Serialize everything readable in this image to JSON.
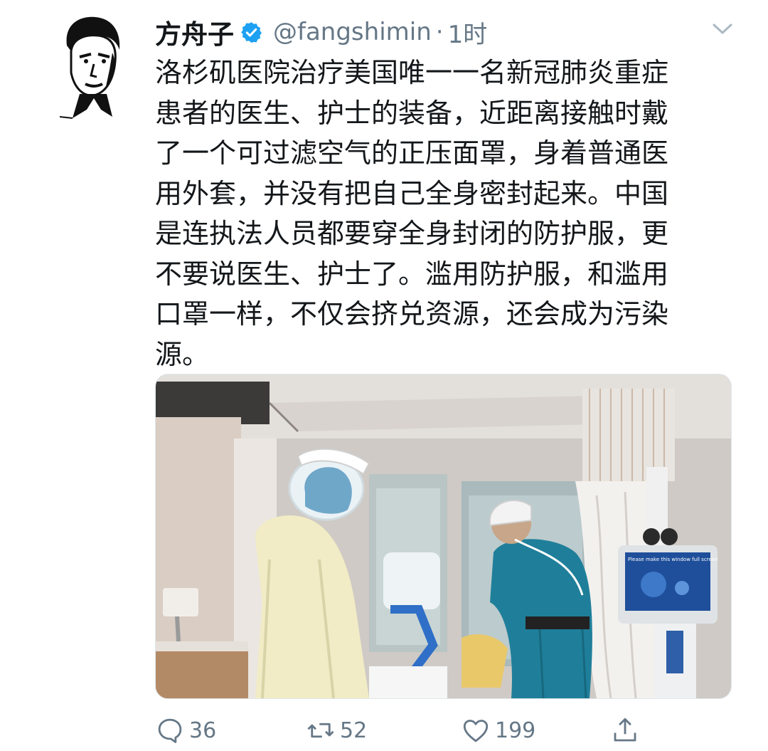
{
  "tweet": {
    "display_name": "方舟子",
    "handle": "@fangshimin",
    "separator": "·",
    "time": "1时",
    "verified": true,
    "text_lines": [
      "洛杉矶医院治疗美国唯一一名新冠肺炎重症",
      "患者的医生、护士的装备，近距离接触时戴",
      "了一个可过滤空气的正压面罩，身着普通医",
      "用外套，并没有把自己全身密封起来。中国",
      "是连执法人员都要穿全身封闭的防护服，更",
      "不要说医生、护士了。滥用防护服，和滥用",
      "口罩一样，不仅会挤兑资源，还会成为污染",
      "源。"
    ],
    "monitor_text": "Please make this window full screen",
    "actions": {
      "reply_count": "36",
      "retweet_count": "52",
      "like_count": "199"
    }
  },
  "colors": {
    "accent": "#1da1f2",
    "secondary_text": "#657786",
    "primary_text": "#14171a"
  },
  "icons": [
    "avatar",
    "verified-badge-icon",
    "chevron-down-icon",
    "reply-icon",
    "retweet-icon",
    "like-icon",
    "share-icon"
  ]
}
